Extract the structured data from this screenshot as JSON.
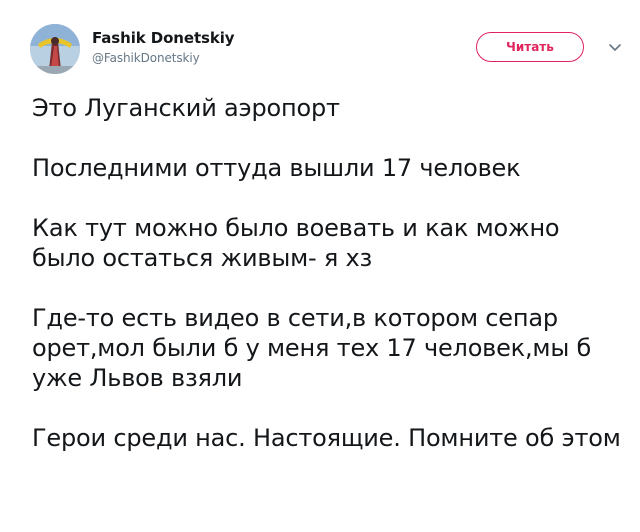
{
  "author": {
    "display_name": "Fashik Donetskiy",
    "handle": "@FashikDonetskiy"
  },
  "follow_button": {
    "label": "Читать"
  },
  "tweet": {
    "paragraphs": [
      "Это Луганский аэропорт",
      "Последними оттуда вышли 17 человек",
      "Как тут можно было воевать и как можно было остаться живым- я хз",
      "Где-то есть видео в сети,в котором сепар орет,мол были б у меня тех 17 человек,мы б уже Львов взяли",
      "Герои среди нас. Настоящие. Помните об этом"
    ]
  },
  "colors": {
    "accent": "#e0245e",
    "text": "#14171a",
    "muted": "#657786"
  },
  "icons": {
    "avatar": "avatar-image",
    "more": "chevron-down-icon"
  }
}
